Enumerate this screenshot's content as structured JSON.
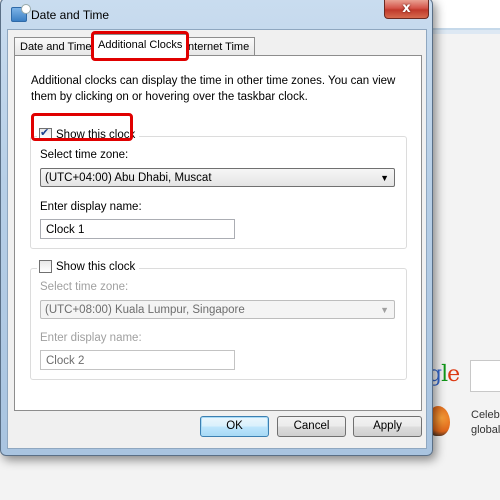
{
  "window": {
    "title": "Date and Time",
    "close_label": "x"
  },
  "tabs": [
    {
      "label": "Date and Time",
      "active": false
    },
    {
      "label": "Additional Clocks",
      "active": true
    },
    {
      "label": "Internet Time",
      "active": false
    }
  ],
  "intro_text": "Additional clocks can display the time in other time zones. You can view them by clicking on or hovering over the taskbar clock.",
  "clocks": [
    {
      "show_label": "Show this clock",
      "checked": true,
      "timezone_label": "Select time zone:",
      "timezone_value": "(UTC+04:00) Abu Dhabi, Muscat",
      "name_label": "Enter display name:",
      "name_value": "Clock 1"
    },
    {
      "show_label": "Show this clock",
      "checked": false,
      "timezone_label": "Select time zone:",
      "timezone_value": "(UTC+08:00) Kuala Lumpur, Singapore",
      "name_label": "Enter display name:",
      "name_value": "Clock 2"
    }
  ],
  "buttons": {
    "ok": "OK",
    "cancel": "Cancel",
    "apply": "Apply"
  },
  "highlight_color": "#e00000",
  "background_page": {
    "logo_fragment": "gle",
    "text_lines": [
      "Celeb",
      "global"
    ]
  }
}
